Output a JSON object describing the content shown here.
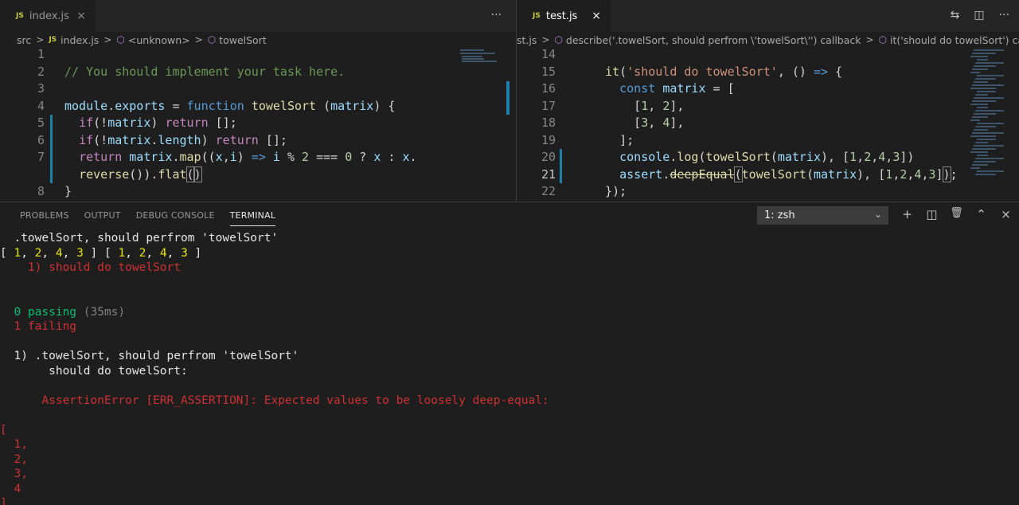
{
  "left_editor": {
    "tab": {
      "badge": "JS",
      "name": "index.js",
      "close": "×"
    },
    "more_actions": "···",
    "breadcrumb": [
      "src",
      "index.js",
      "<unknown>",
      "towelSort"
    ],
    "breadcrumb_js_badge": "JS",
    "lines": [
      {
        "n": "1",
        "tokens": []
      },
      {
        "n": "2",
        "tokens": [
          [
            "cmt",
            "// You should implement your task here."
          ]
        ]
      },
      {
        "n": "3",
        "tokens": []
      },
      {
        "n": "4",
        "tokens": [
          [
            "var",
            "module"
          ],
          [
            "plain",
            "."
          ],
          [
            "var",
            "exports"
          ],
          [
            "plain",
            " = "
          ],
          [
            "kw",
            "function"
          ],
          [
            "plain",
            " "
          ],
          [
            "fn",
            "towelSort"
          ],
          [
            "plain",
            " ("
          ],
          [
            "var",
            "matrix"
          ],
          [
            "plain",
            ") {"
          ]
        ]
      },
      {
        "n": "5",
        "tokens": [
          [
            "plain",
            "  "
          ],
          [
            "ctrl",
            "if"
          ],
          [
            "plain",
            "(!"
          ],
          [
            "var",
            "matrix"
          ],
          [
            "plain",
            ") "
          ],
          [
            "ctrl",
            "return"
          ],
          [
            "plain",
            " [];"
          ]
        ]
      },
      {
        "n": "6",
        "tokens": [
          [
            "plain",
            "  "
          ],
          [
            "ctrl",
            "if"
          ],
          [
            "plain",
            "(!"
          ],
          [
            "var",
            "matrix"
          ],
          [
            "plain",
            "."
          ],
          [
            "var",
            "length"
          ],
          [
            "plain",
            ") "
          ],
          [
            "ctrl",
            "return"
          ],
          [
            "plain",
            " [];"
          ]
        ]
      },
      {
        "n": "7",
        "tokens": [
          [
            "plain",
            "  "
          ],
          [
            "ctrl",
            "return"
          ],
          [
            "plain",
            " "
          ],
          [
            "var",
            "matrix"
          ],
          [
            "plain",
            "."
          ],
          [
            "fn",
            "map"
          ],
          [
            "plain",
            "(("
          ],
          [
            "var",
            "x"
          ],
          [
            "plain",
            ","
          ],
          [
            "var",
            "i"
          ],
          [
            "plain",
            ") "
          ],
          [
            "kw",
            "=>"
          ],
          [
            "plain",
            " "
          ],
          [
            "var",
            "i"
          ],
          [
            "plain",
            " % "
          ],
          [
            "num",
            "2"
          ],
          [
            "plain",
            " === "
          ],
          [
            "num",
            "0"
          ],
          [
            "plain",
            " ? "
          ],
          [
            "var",
            "x"
          ],
          [
            "plain",
            " : "
          ],
          [
            "var",
            "x"
          ],
          [
            "plain",
            "."
          ]
        ]
      },
      {
        "n": "",
        "tokens": [
          [
            "plain",
            "  "
          ],
          [
            "fn",
            "reverse"
          ],
          [
            "plain",
            "())."
          ],
          [
            "fn",
            "flat"
          ],
          [
            "plain",
            "("
          ],
          [
            "plain",
            ")"
          ]
        ]
      },
      {
        "n": "8",
        "tokens": [
          [
            "plain",
            "}"
          ]
        ]
      }
    ]
  },
  "right_editor": {
    "tab": {
      "badge": "JS",
      "name": "test.js",
      "close": "×"
    },
    "actions": [
      "⇆",
      "◫",
      "···"
    ],
    "breadcrumb": [
      "st.js",
      "describe('.towelSort, should perfrom \\'towelSort\\'') callback",
      "it('should do towelSort') callback"
    ],
    "lines": [
      {
        "n": "14",
        "tokens": []
      },
      {
        "n": "15",
        "tokens": [
          [
            "plain",
            "  "
          ],
          [
            "fn",
            "it"
          ],
          [
            "plain",
            "("
          ],
          [
            "str",
            "'should do towelSort'"
          ],
          [
            "plain",
            ", () "
          ],
          [
            "kw",
            "=>"
          ],
          [
            "plain",
            " {"
          ]
        ]
      },
      {
        "n": "16",
        "tokens": [
          [
            "plain",
            "    "
          ],
          [
            "kw",
            "const"
          ],
          [
            "plain",
            " "
          ],
          [
            "var",
            "matrix"
          ],
          [
            "plain",
            " = ["
          ]
        ]
      },
      {
        "n": "17",
        "tokens": [
          [
            "plain",
            "      ["
          ],
          [
            "num",
            "1"
          ],
          [
            "plain",
            ", "
          ],
          [
            "num",
            "2"
          ],
          [
            "plain",
            "],"
          ]
        ]
      },
      {
        "n": "18",
        "tokens": [
          [
            "plain",
            "      ["
          ],
          [
            "num",
            "3"
          ],
          [
            "plain",
            ", "
          ],
          [
            "num",
            "4"
          ],
          [
            "plain",
            "],"
          ]
        ]
      },
      {
        "n": "19",
        "tokens": [
          [
            "plain",
            "    ];"
          ]
        ]
      },
      {
        "n": "20",
        "tokens": [
          [
            "plain",
            "    "
          ],
          [
            "var",
            "console"
          ],
          [
            "plain",
            "."
          ],
          [
            "fn",
            "log"
          ],
          [
            "plain",
            "("
          ],
          [
            "fn",
            "towelSort"
          ],
          [
            "plain",
            "("
          ],
          [
            "var",
            "matrix"
          ],
          [
            "plain",
            "), ["
          ],
          [
            "num",
            "1"
          ],
          [
            "plain",
            ","
          ],
          [
            "num",
            "2"
          ],
          [
            "plain",
            ","
          ],
          [
            "num",
            "4"
          ],
          [
            "plain",
            ","
          ],
          [
            "num",
            "3"
          ],
          [
            "plain",
            "])"
          ]
        ]
      },
      {
        "n": "21",
        "tokens": [
          [
            "plain",
            "    "
          ],
          [
            "var",
            "assert"
          ],
          [
            "plain",
            "."
          ],
          [
            "fn",
            "deepEqual"
          ],
          [
            "plain",
            "("
          ],
          [
            "fn",
            "towelSort"
          ],
          [
            "plain",
            "("
          ],
          [
            "var",
            "matrix"
          ],
          [
            "plain",
            "), ["
          ],
          [
            "num",
            "1"
          ],
          [
            "plain",
            ","
          ],
          [
            "num",
            "2"
          ],
          [
            "plain",
            ","
          ],
          [
            "num",
            "4"
          ],
          [
            "plain",
            ","
          ],
          [
            "num",
            "3"
          ],
          [
            "plain",
            "]"
          ],
          [
            "plain",
            ")"
          ],
          [
            "plain",
            ";"
          ]
        ]
      },
      {
        "n": "22",
        "tokens": [
          [
            "plain",
            "  });"
          ]
        ]
      }
    ]
  },
  "panel": {
    "tabs": [
      "PROBLEMS",
      "OUTPUT",
      "DEBUG CONSOLE",
      "TERMINAL"
    ],
    "active_tab": "TERMINAL",
    "shell": "1: zsh",
    "actions": [
      "+",
      "◫",
      "🗑",
      "⌃",
      "×"
    ]
  },
  "terminal": [
    {
      "spans": [
        [
          "t-white",
          "  .towelSort, should perfrom 'towelSort'"
        ]
      ]
    },
    {
      "spans": [
        [
          "t-white",
          "[ "
        ],
        [
          "t-yellow",
          "1"
        ],
        [
          "t-white",
          ", "
        ],
        [
          "t-yellow",
          "2"
        ],
        [
          "t-white",
          ", "
        ],
        [
          "t-yellow",
          "4"
        ],
        [
          "t-white",
          ", "
        ],
        [
          "t-yellow",
          "3"
        ],
        [
          "t-white",
          " ] [ "
        ],
        [
          "t-yellow",
          "1"
        ],
        [
          "t-white",
          ", "
        ],
        [
          "t-yellow",
          "2"
        ],
        [
          "t-white",
          ", "
        ],
        [
          "t-yellow",
          "4"
        ],
        [
          "t-white",
          ", "
        ],
        [
          "t-yellow",
          "3"
        ],
        [
          "t-white",
          " ]"
        ]
      ]
    },
    {
      "spans": [
        [
          "t-red",
          "    1) should do towelSort"
        ]
      ]
    },
    {
      "spans": []
    },
    {
      "spans": []
    },
    {
      "spans": [
        [
          "t-green",
          "  0 passing"
        ],
        [
          "t-gray",
          " (35ms)"
        ]
      ]
    },
    {
      "spans": [
        [
          "t-red",
          "  1 failing"
        ]
      ]
    },
    {
      "spans": []
    },
    {
      "spans": [
        [
          "t-white",
          "  1) .towelSort, should perfrom 'towelSort'"
        ]
      ]
    },
    {
      "spans": [
        [
          "t-white",
          "       should do towelSort:"
        ]
      ]
    },
    {
      "spans": []
    },
    {
      "spans": [
        [
          "t-red",
          "      AssertionError [ERR_ASSERTION]: Expected values to be loosely deep-equal:"
        ]
      ]
    },
    {
      "spans": []
    },
    {
      "spans": [
        [
          "t-red",
          "["
        ]
      ]
    },
    {
      "spans": [
        [
          "t-red",
          "  1,"
        ]
      ]
    },
    {
      "spans": [
        [
          "t-red",
          "  2,"
        ]
      ]
    },
    {
      "spans": [
        [
          "t-red",
          "  3,"
        ]
      ]
    },
    {
      "spans": [
        [
          "t-red",
          "  4"
        ]
      ]
    },
    {
      "spans": [
        [
          "t-red",
          "]"
        ]
      ]
    }
  ]
}
